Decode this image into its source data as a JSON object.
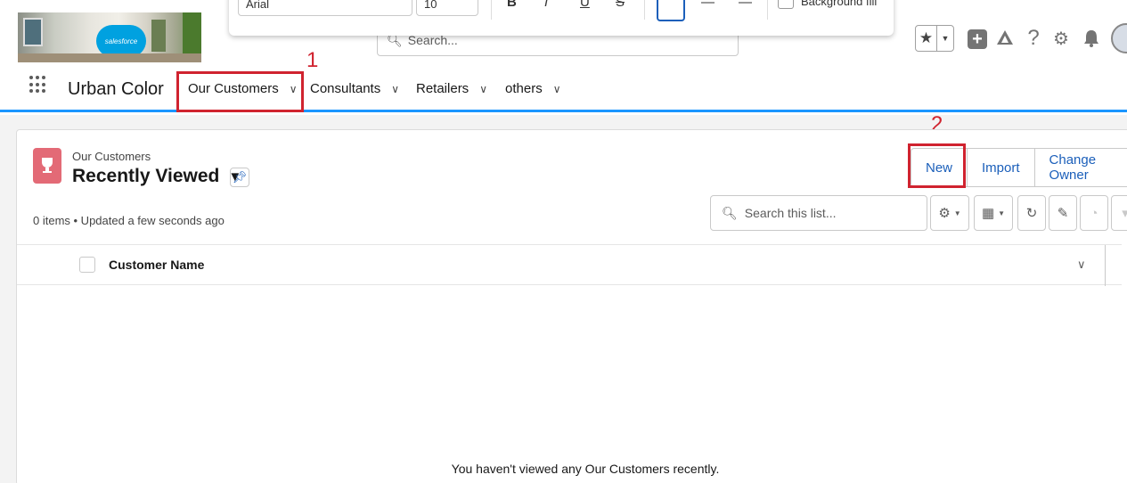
{
  "header": {
    "logo_text": "salesforce",
    "search_placeholder": "Search...",
    "rte_toolbar": {
      "font": "Arial",
      "size": "10",
      "bold": "B",
      "italic": "I",
      "underline": "U",
      "strike": "S",
      "background_fill": "Background fill"
    },
    "utility_icons": [
      "star-icon",
      "plus-icon",
      "trailhead-icon",
      "help-icon",
      "gear-icon",
      "bell-icon"
    ],
    "help_glyph": "?"
  },
  "nav": {
    "app_name": "Urban Color",
    "items": [
      {
        "label": "Our Customers",
        "active": true
      },
      {
        "label": "Consultants"
      },
      {
        "label": "Retailers"
      },
      {
        "label": "others"
      }
    ]
  },
  "annotations": {
    "step1": "1",
    "step2": "2"
  },
  "list": {
    "object_label": "Our Customers",
    "title": "Recently Viewed",
    "meta": "0 items • Updated a few seconds ago",
    "buttons": {
      "new": "New",
      "import": "Import",
      "change_owner": "Change Owner"
    },
    "search_placeholder": "Search this list...",
    "columns": [
      "Customer Name"
    ],
    "empty_message": "You haven't viewed any Our Customers recently."
  },
  "colors": {
    "accent": "#1b96ff",
    "highlight": "#d0232f",
    "object_icon": "#e36a76",
    "link": "#1b5fba"
  }
}
